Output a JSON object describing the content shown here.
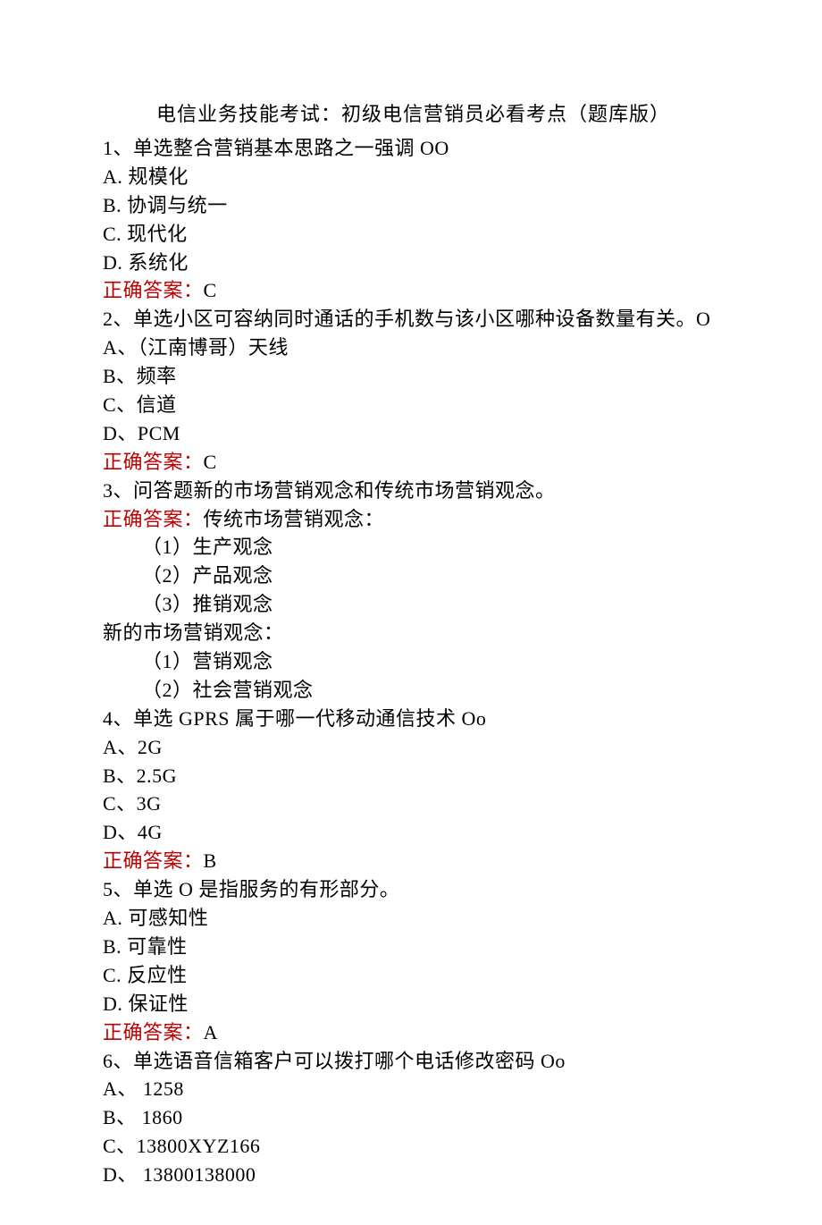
{
  "title": "电信业务技能考试：初级电信营销员必看考点（题库版）",
  "q1": {
    "stem": "1、单选整合营销基本思路之一强调 OO",
    "a": "A. 规模化",
    "b": "B. 协调与统一",
    "c": "C. 现代化",
    "d": "D. 系统化",
    "ans_label": "正确答案：",
    "ans_value": "C"
  },
  "q2": {
    "stem": "2、单选小区可容纳同时通话的手机数与该小区哪种设备数量有关。O",
    "a": "A、（江南博哥）天线",
    "b": "B、频率",
    "c": "C、信道",
    "d": "D、PCM",
    "ans_label": "正确答案：",
    "ans_value": "C"
  },
  "q3": {
    "stem": "3、问答题新的市场营销观念和传统市场营销观念。",
    "ans_label": "正确答案：",
    "ans_prefix": "传统市场营销观念：",
    "l1": "（1）生产观念",
    "l2": "（2）产品观念",
    "l3": "（3）推销观念",
    "sub2": "新的市场营销观念：",
    "l4": "（1）营销观念",
    "l5": "（2）社会营销观念"
  },
  "q4": {
    "stem": "4、单选 GPRS 属于哪一代移动通信技术 Oo",
    "a": "A、2G",
    "b": "B、2.5G",
    "c": "C、3G",
    "d": "D、4G",
    "ans_label": "正确答案：",
    "ans_value": "B"
  },
  "q5": {
    "stem": "5、单选 O 是指服务的有形部分。",
    "a": "A. 可感知性",
    "b": "B. 可靠性",
    "c": "C. 反应性",
    "d": "D. 保证性",
    "ans_label": "正确答案：",
    "ans_value": "A"
  },
  "q6": {
    "stem": "6、单选语音信箱客户可以拨打哪个电话修改密码 Oo",
    "a": "A、 1258",
    "b": "B、 1860",
    "c": "C、13800XYZ166",
    "d": "D、 13800138000"
  }
}
